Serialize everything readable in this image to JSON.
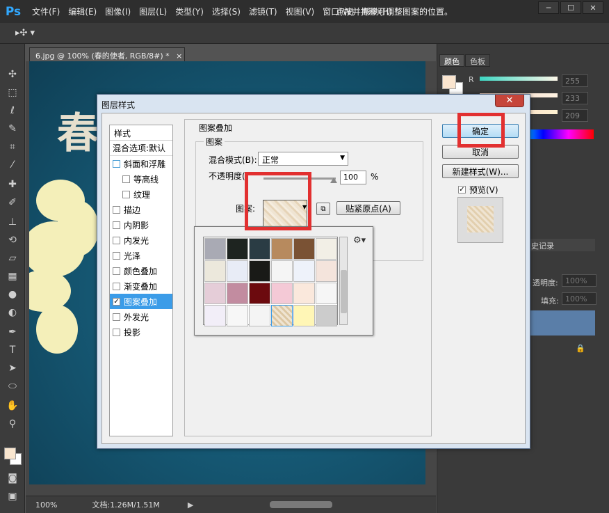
{
  "app": {
    "logo": "Ps",
    "menu": [
      "文件(F)",
      "编辑(E)",
      "图像(I)",
      "图层(L)",
      "类型(Y)",
      "选择(S)",
      "滤镜(T)",
      "视图(V)",
      "窗口(W)",
      "帮助(H)"
    ],
    "window_buttons": [
      "─",
      "☐",
      "✕"
    ]
  },
  "options_bar": {
    "tool": "▸✣ ▾",
    "hint": "点按并拖移可调整图案的位置。"
  },
  "document": {
    "tab_label": "6.jpg @ 100% (春的使者, RGB/8#) *",
    "tab_close": "×",
    "canvas_title": "春的使者"
  },
  "statusbar": {
    "zoom": "100%",
    "doc_info": "文档:1.26M/1.51M"
  },
  "panels": {
    "color_tabs": [
      "颜色",
      "色板"
    ],
    "channel_label": "R",
    "values": [
      "255",
      "233",
      "209"
    ],
    "history_header": "史记录",
    "opacity_label": "透明度:",
    "opacity_value": "100%",
    "fill_label": "填充:",
    "fill_value": "100%"
  },
  "dialog": {
    "title": "图层样式",
    "close": "✕",
    "style_header": "样式",
    "blend_options": "混合选项:默认",
    "styles": [
      {
        "label": "斜面和浮雕",
        "checked": false,
        "sub": false
      },
      {
        "label": "等高线",
        "checked": false,
        "sub": true
      },
      {
        "label": "纹理",
        "checked": false,
        "sub": true
      },
      {
        "label": "描边",
        "checked": false,
        "sub": false
      },
      {
        "label": "内阴影",
        "checked": false,
        "sub": false
      },
      {
        "label": "内发光",
        "checked": false,
        "sub": false
      },
      {
        "label": "光泽",
        "checked": false,
        "sub": false
      },
      {
        "label": "颜色叠加",
        "checked": false,
        "sub": false
      },
      {
        "label": "渐变叠加",
        "checked": false,
        "sub": false
      },
      {
        "label": "图案叠加",
        "checked": true,
        "sub": false
      },
      {
        "label": "外发光",
        "checked": false,
        "sub": false
      },
      {
        "label": "投影",
        "checked": false,
        "sub": false
      }
    ],
    "section_title": "图案叠加",
    "subsection_title": "图案",
    "blend_mode_label": "混合模式(B):",
    "blend_mode_value": "正常",
    "opacity_label": "不透明度(",
    "opacity_value": "100",
    "percent": "%",
    "pattern_label": "图案:",
    "snap_button": "贴紧原点(A)",
    "ok_button": "确定",
    "cancel_button": "取消",
    "new_style_button": "新建样式(W)...",
    "preview_label": "预览(V)",
    "preview_checked": true
  },
  "pattern_swatches": [
    "#a9aab4",
    "#1e2420",
    "#2a3c44",
    "#b78a5e",
    "#7a5234",
    "#f2efe6",
    "#ece8dc",
    "#e8ecf6",
    "#191a17",
    "#f5f5f5",
    "#eef2fa",
    "#f4e4dc",
    "#e5cdd8",
    "#c28ca0",
    "#6c0a0e",
    "#f4c9d6",
    "#fae8dc",
    "#f6f6f6",
    "#f2eef8",
    "#f7f7f7",
    "#f4f4f4",
    "#eadcc2",
    "#fff6b6",
    "#cccccc"
  ],
  "colors": {
    "highlight": "#e23030",
    "selection": "#3b9ce8",
    "canvas": "#165a76"
  }
}
